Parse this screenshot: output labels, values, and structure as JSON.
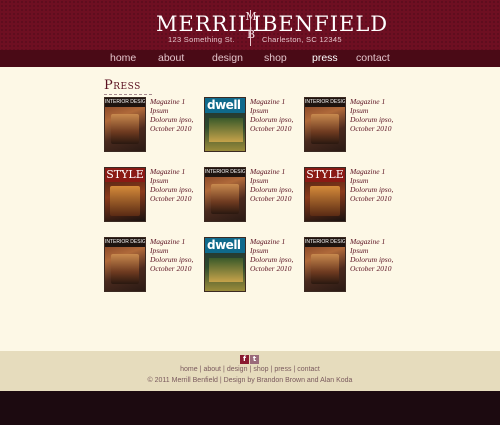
{
  "header": {
    "brand_left": "MERRILL",
    "brand_right": "BENFIELD",
    "monogram_top": "M",
    "monogram_bottom": "B",
    "address_left": "123 Something St.",
    "address_right": "Charleston, SC 12345"
  },
  "nav": {
    "items": [
      {
        "label": "home",
        "active": false
      },
      {
        "label": "about",
        "active": false
      },
      {
        "label": "design",
        "active": false
      },
      {
        "label": "shop",
        "active": false
      },
      {
        "label": "press",
        "active": true
      },
      {
        "label": "contact",
        "active": false
      }
    ]
  },
  "main": {
    "title": "Press",
    "items": [
      {
        "cover": "design",
        "cover_label": "INTERIOR DESIGN",
        "line1": "Magazine 1",
        "line2": "Ipsum",
        "line3": "Dolorum ipso,",
        "line4": "October 2010"
      },
      {
        "cover": "dwell",
        "cover_label": "dwell",
        "line1": "Magazine 1",
        "line2": "Ipsum",
        "line3": "Dolorum ipso,",
        "line4": "October 2010"
      },
      {
        "cover": "design",
        "cover_label": "INTERIOR DESIGN",
        "line1": "Magazine 1",
        "line2": "Ipsum",
        "line3": "Dolorum ipso,",
        "line4": "October 2010"
      },
      {
        "cover": "style",
        "cover_label": "STYLE",
        "line1": "Magazine 1",
        "line2": "Ipsum",
        "line3": "Dolorum ipso,",
        "line4": "October 2010"
      },
      {
        "cover": "design",
        "cover_label": "INTERIOR DESIGN",
        "line1": "Magazine 1",
        "line2": "Ipsum",
        "line3": "Dolorum ipso,",
        "line4": "October 2010"
      },
      {
        "cover": "style",
        "cover_label": "STYLE",
        "line1": "Magazine 1",
        "line2": "Ipsum",
        "line3": "Dolorum ipso,",
        "line4": "October 2010"
      },
      {
        "cover": "design",
        "cover_label": "INTERIOR DESIGN",
        "line1": "Magazine 1",
        "line2": "Ipsum",
        "line3": "Dolorum ipso,",
        "line4": "October 2010"
      },
      {
        "cover": "dwell",
        "cover_label": "dwell",
        "line1": "Magazine 1",
        "line2": "Ipsum",
        "line3": "Dolorum ipso,",
        "line4": "October 2010"
      },
      {
        "cover": "design",
        "cover_label": "INTERIOR DESIGN",
        "line1": "Magazine 1",
        "line2": "Ipsum",
        "line3": "Dolorum ipso,",
        "line4": "October 2010"
      }
    ]
  },
  "footer": {
    "social": [
      {
        "icon": "facebook-icon",
        "glyph": "f"
      },
      {
        "icon": "twitter-icon",
        "glyph": "t"
      }
    ],
    "links": [
      "home",
      "about",
      "design",
      "shop",
      "press",
      "contact"
    ],
    "separator": "|",
    "copyright": "© 2011 Merrill Benfield | Design by Brandon Brown and Alan Koda"
  },
  "colors": {
    "header_bg": "#6e0f22",
    "nav_bg": "#4a0a16",
    "content_bg": "#fdf8e6",
    "footer_bg": "#e6dcbd",
    "bottom_bg": "#1c0a10",
    "accent_text": "#5a1020"
  }
}
